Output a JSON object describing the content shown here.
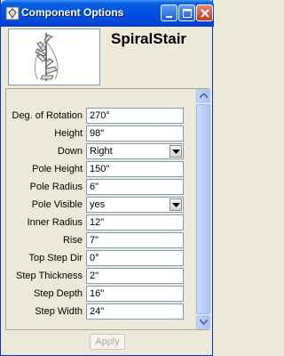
{
  "window": {
    "title": "Component Options",
    "title_bar_color": "#0054e3"
  },
  "component": {
    "name": "SpiralStair",
    "preview_icon": "spiral-stair-preview"
  },
  "properties": [
    {
      "label": "Deg. of Rotation",
      "value": "270°",
      "type": "text"
    },
    {
      "label": "Height",
      "value": "98\"",
      "type": "text"
    },
    {
      "label": "Down",
      "value": "Right",
      "type": "select"
    },
    {
      "label": "Pole Height",
      "value": "150\"",
      "type": "text"
    },
    {
      "label": "Pole Radius",
      "value": "6\"",
      "type": "text"
    },
    {
      "label": "Pole Visible",
      "value": "yes",
      "type": "select"
    },
    {
      "label": "Inner Radius",
      "value": "12\"",
      "type": "text"
    },
    {
      "label": "Rise",
      "value": "7\"",
      "type": "text"
    },
    {
      "label": "Top Step Dir",
      "value": "0°",
      "type": "text"
    },
    {
      "label": "Step Thickness",
      "value": "2\"",
      "type": "text"
    },
    {
      "label": "Step Depth",
      "value": "16\"",
      "type": "text"
    },
    {
      "label": "Step Width",
      "value": "24\"",
      "type": "text"
    }
  ],
  "footer": {
    "apply_label": "Apply"
  }
}
